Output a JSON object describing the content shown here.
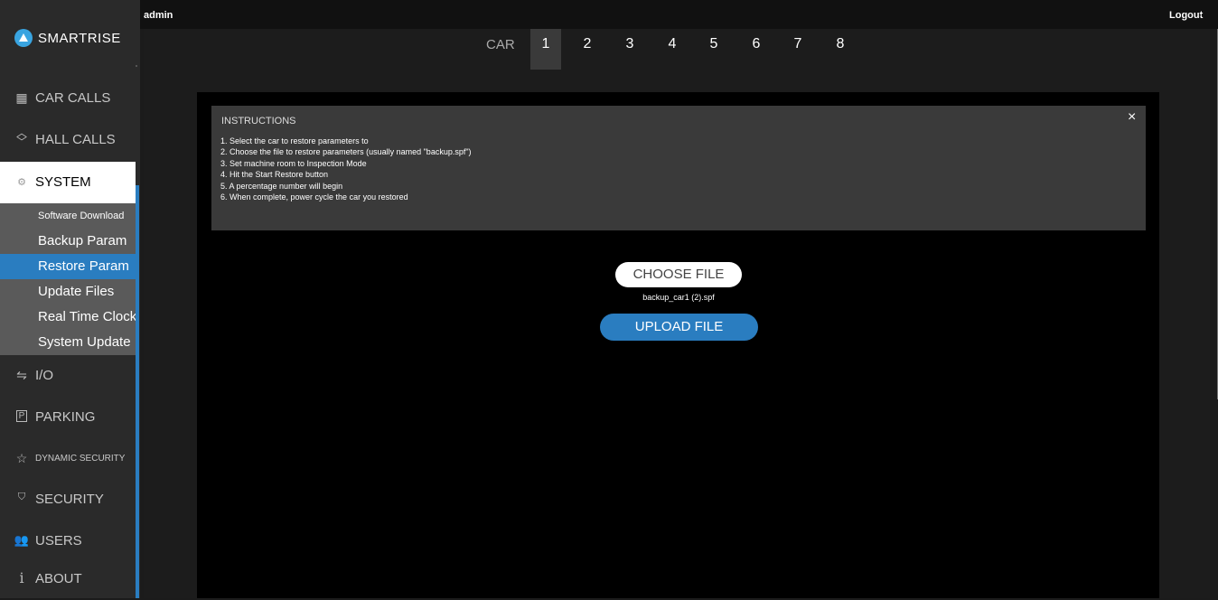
{
  "header": {
    "user": "admin",
    "logout": "Logout"
  },
  "brand": {
    "name": "SMARTRISE",
    "accent": "#39a4e0"
  },
  "car_selector": {
    "label": "CAR",
    "cars": [
      "1",
      "2",
      "3",
      "4",
      "5",
      "6",
      "7",
      "8"
    ],
    "selected": "1"
  },
  "sidebar": {
    "items": [
      {
        "label": "CAR CALLS",
        "icon": "car-calls-icon"
      },
      {
        "label": "HALL CALLS",
        "icon": "hall-calls-icon"
      },
      {
        "label": "SYSTEM",
        "icon": "gear-icon"
      },
      {
        "label": "I/O",
        "icon": "io-arrows-icon"
      },
      {
        "label": "PARKING",
        "icon": "parking-icon"
      },
      {
        "label": "DYNAMIC SECURITY",
        "icon": "star-icon"
      },
      {
        "label": "SECURITY",
        "icon": "shield-icon"
      },
      {
        "label": "USERS",
        "icon": "users-icon"
      },
      {
        "label": "ABOUT",
        "icon": "info-icon"
      }
    ],
    "system_submenu": [
      "Software Download",
      "Backup Param",
      "Restore Param",
      "Update Files",
      "Real Time Clock",
      "System Update"
    ],
    "selected_submenu": "Restore Param"
  },
  "instructions": {
    "title": "INSTRUCTIONS",
    "steps": [
      "1. Select the car to restore parameters to",
      "2. Choose the file to restore parameters (usually named \"backup.spf\")",
      "3. Set machine room to Inspection Mode",
      "4. Hit the Start Restore button",
      "5. A percentage number will begin",
      "6. When complete, power cycle the car you restored"
    ],
    "close_symbol": "×"
  },
  "restore": {
    "choose_label": "CHOOSE FILE",
    "filename": "backup_car1 (2).spf",
    "upload_label": "UPLOAD FILE"
  },
  "colors": {
    "accent_blue": "#2a7dc0",
    "background": "#000000"
  }
}
